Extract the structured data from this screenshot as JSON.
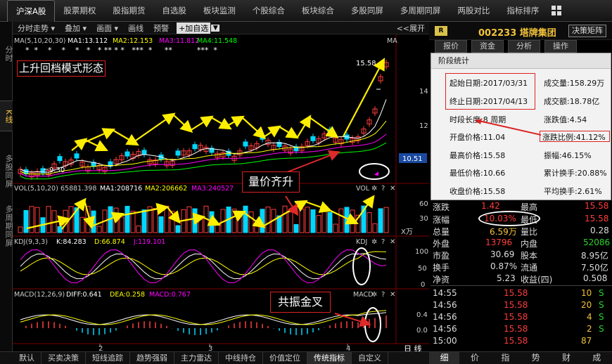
{
  "topnav": {
    "tabs": [
      "沪深A股",
      "股票期权",
      "股指期货",
      "自选股",
      "板块监测",
      "个股综合",
      "板块综合",
      "多股同屏",
      "多周期同屏",
      "两股对比",
      "指标排序"
    ]
  },
  "side_tabs": [
    "分时",
    "K线",
    "多股同屏",
    "多周期同屏"
  ],
  "chart_toolbar": {
    "items": [
      "分时走势",
      "叠加",
      "画面",
      "画线",
      "预警"
    ],
    "add_label": "+加自选",
    "expand_label": "<<展开"
  },
  "main_chart": {
    "legend": {
      "ma_label": "MA(5,10,20,30)",
      "ma1": "MA1:13.112",
      "ma2": "MA2:12.153",
      "ma3": "MA3:11.812",
      "ma4": "MA4:11.548"
    },
    "stars": "*  *    *    *    *   *   * ** * *   ***  *     **          ***  *",
    "high_label": "15.58",
    "low_label": "9.30",
    "y_ticks": [
      "14",
      "12"
    ],
    "current_price": "10.51",
    "annotation": "上升回档模式形态",
    "colors": {
      "ma1": "#ffffff",
      "ma2": "#ffff00",
      "ma3": "#ff00ff",
      "ma4": "#00ff00",
      "up": "#ff3c3c",
      "down": "#00d7ff",
      "arrow": "#ffee00"
    }
  },
  "vol_chart": {
    "label": "VOL(5,10,20)",
    "value": "65881.398",
    "ma1": "MA1:208716",
    "ma2": "MA2:206662",
    "ma3": "MA3:240527",
    "tag": "VOL",
    "y_ticks": [
      "60",
      "30"
    ],
    "unit": "X万",
    "annotation": "量价齐升"
  },
  "kdj_chart": {
    "label": "KDJ(9,3,3)",
    "k": "K:84.283",
    "d": "D:66.874",
    "j": "J:119.101",
    "tag": "KDJ",
    "y_ticks": [
      "100",
      "50",
      "0"
    ]
  },
  "macd_chart": {
    "label": "MACD(12,26,9)",
    "diff": "DIFF:0.641",
    "dea": "DEA:0.258",
    "macd": "MACD:0.767",
    "tag": "MACD",
    "y_ticks": [
      "0.4",
      "0.0"
    ],
    "annotation": "共振金叉"
  },
  "x_axis": {
    "labels": [
      "2",
      "3",
      "4"
    ],
    "period_label": "日 线"
  },
  "bottom_tabs": [
    "默认",
    "买卖决策",
    "短线追踪",
    "趋势强弱",
    "主力雷达",
    "中线持仓",
    "价值定位",
    "传统指标",
    "自定义"
  ],
  "stock": {
    "badge": "R",
    "code_name": "002233 塔牌集团",
    "decision_btn": "决策矩阵",
    "tabs": [
      "报价",
      "资金",
      "分析",
      "操作"
    ]
  },
  "stats_popup": {
    "title": "阶段统计",
    "start_date": "起始日期:2017/03/31",
    "end_date": "终止日期:2017/04/13",
    "length": "时段长度:8 周期",
    "open": "开盘价格:11.04",
    "high": "最高价格:15.58",
    "low": "最低价格:10.66",
    "close": "收盘价格:15.58",
    "volume": "成交量:158.29万",
    "amount": "成交额:18.78亿",
    "change": "涨跌值:4.54",
    "change_pct": "涨跌比例:41.12%",
    "amplitude": "振幅:46.15%",
    "cum_turnover": "累计换手:20.88%",
    "avg_turnover": "平均换手:2.61%"
  },
  "quote": {
    "rows": [
      {
        "l1": "涨跌",
        "v1": "1.42",
        "l2": "最高",
        "v2": "15.58"
      },
      {
        "l1": "涨幅",
        "v1": "10.03%",
        "l2": "最低",
        "v2": "15.58"
      },
      {
        "l1": "总量",
        "v1": "6.59万",
        "l2": "量比",
        "v2": "0.28"
      },
      {
        "l1": "外盘",
        "v1": "13796",
        "l2": "内盘",
        "v2": "52086"
      },
      {
        "l1": "市盈",
        "v1": "30.69",
        "l2": "股本",
        "v2": "8.95亿"
      },
      {
        "l1": "换手",
        "v1": "0.87%",
        "l2": "流通",
        "v2": "7.50亿"
      },
      {
        "l1": "净资",
        "v1": "5.23",
        "l2": "收益(四)",
        "v2": "0.508"
      }
    ],
    "ticks": [
      {
        "time": "14:55",
        "price": "15.58",
        "vol": "10",
        "side": "S"
      },
      {
        "time": "14:56",
        "price": "15.58",
        "vol": "20",
        "side": "S"
      },
      {
        "time": "14:56",
        "price": "15.58",
        "vol": "4",
        "side": "S"
      },
      {
        "time": "14:56",
        "price": "15.58",
        "vol": "2",
        "side": "S"
      },
      {
        "time": "15:00",
        "price": "15.58",
        "vol": "87",
        "side": ""
      }
    ]
  },
  "right_bottom_tabs": [
    "细",
    "价",
    "指",
    "势",
    "财",
    "成"
  ]
}
